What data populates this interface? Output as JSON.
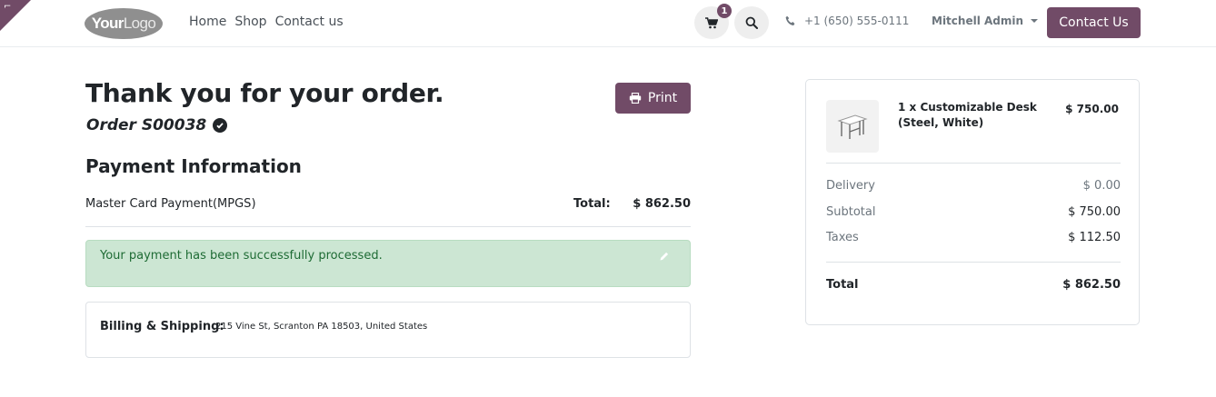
{
  "colors": {
    "brand": "#714B67",
    "success_bg": "#cce6d3",
    "success_text": "#1e6b34",
    "muted": "#6c757d"
  },
  "header": {
    "logo_bold": "Your",
    "logo_light": "Logo",
    "nav": [
      "Home",
      "Shop",
      "Contact us"
    ],
    "cart_count": "1",
    "phone": "+1 (650) 555-0111",
    "user": "Mitchell Admin",
    "contact_button": "Contact Us",
    "icons": {
      "cart": "cart-icon",
      "search": "search-icon",
      "phone": "phone-icon",
      "corner": "edit-corner-icon"
    }
  },
  "confirmation": {
    "title": "Thank you for your order.",
    "order": "Order S00038",
    "print_label": "Print",
    "payment_title": "Payment Information",
    "payment_method": "Master Card Payment(MPGS)",
    "total_label": "Total:",
    "total_value": "$ 862.50",
    "alert": "Your payment has been successfully processed.",
    "billing_label": "Billing & Shipping:",
    "billing_address": "215 Vine St, Scranton PA 18503, United States"
  },
  "summary": {
    "product_name": "1 x Customizable Desk (Steel, White)",
    "product_price": "$ 750.00",
    "delivery_label": "Delivery",
    "delivery_value": "$ 0.00",
    "subtotal_label": "Subtotal",
    "subtotal_value": "$ 750.00",
    "taxes_label": "Taxes",
    "taxes_value": "$ 112.50",
    "total_label": "Total",
    "total_value": "$ 862.50"
  }
}
